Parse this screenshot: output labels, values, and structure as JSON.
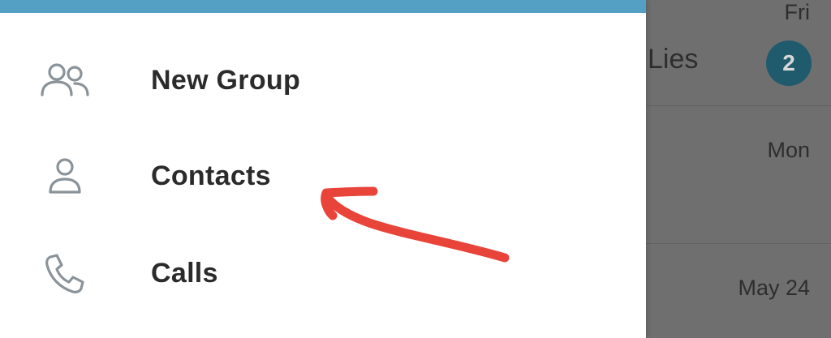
{
  "drawer": {
    "header_color": "#54a0c4",
    "items": [
      {
        "label": "New Group",
        "icon": "group-icon"
      },
      {
        "label": "Contacts",
        "icon": "person-icon"
      },
      {
        "label": "Calls",
        "icon": "phone-icon"
      }
    ]
  },
  "chat_list": {
    "rows": [
      {
        "time": "Fri",
        "name_fragment": "Lies",
        "unread": "2"
      },
      {
        "time": "Mon"
      },
      {
        "time": "May 24"
      }
    ],
    "badge_color": "#1f5a6d"
  },
  "annotation": {
    "type": "arrow",
    "color": "#e8443a",
    "points_to": "Contacts"
  },
  "colors": {
    "icon": "#8a9399",
    "label": "#2b2b2b",
    "overlay": "#6f6f6f"
  }
}
